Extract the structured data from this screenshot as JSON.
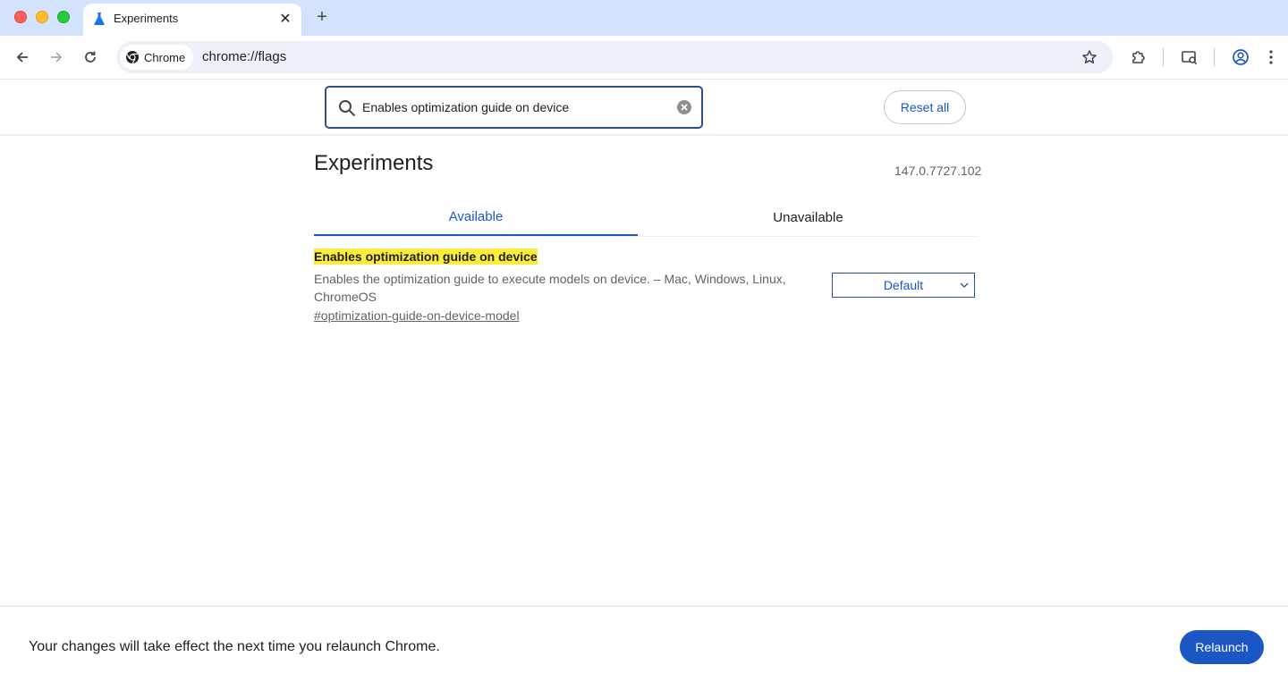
{
  "browser": {
    "tab": {
      "title": "Experiments",
      "favicon": "flask-icon"
    },
    "omnibox": {
      "chip_label": "Chrome",
      "url": "chrome://flags"
    }
  },
  "flags_header": {
    "search": {
      "value": "Enables optimization guide on device",
      "placeholder": "Search flags"
    },
    "reset_label": "Reset all"
  },
  "main": {
    "title": "Experiments",
    "version": "147.0.7727.102",
    "tabs": [
      {
        "label": "Available",
        "active": true
      },
      {
        "label": "Unavailable",
        "active": false
      }
    ],
    "flag": {
      "name": "Enables optimization guide on device",
      "description": "Enables the optimization guide to execute models on device. – Mac, Windows, Linux, ChromeOS",
      "link": "#optimization-guide-on-device-model",
      "selected_option": "Default"
    }
  },
  "footer": {
    "message": "Your changes will take effect the next time you relaunch Chrome.",
    "relaunch_label": "Relaunch"
  },
  "colors": {
    "accent": "#1a56c4",
    "highlight": "#ffeb3b",
    "tabstrip": "#d3e3fd"
  }
}
